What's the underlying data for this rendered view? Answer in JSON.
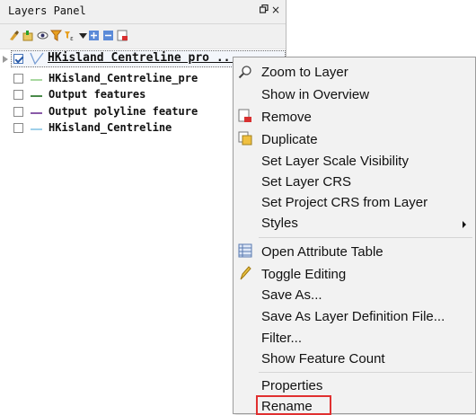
{
  "panel": {
    "title": "Layers Panel",
    "float_icon": "restore-icon",
    "close_glyph": "×",
    "toolbar_icons": [
      "style-brush-icon",
      "add-group-icon",
      "eye-icon",
      "filter-icon",
      "filter-legend-icon",
      "dropdown-icon",
      "expand-all-icon",
      "collapse-all-icon",
      "remove-layer-icon"
    ]
  },
  "layers": [
    {
      "name": "HKisland Centreline pro ...",
      "checked": true,
      "symbol_color": "#7a9fd4",
      "selected": true
    },
    {
      "name": "HKisland_Centreline_pre",
      "checked": false,
      "symbol_color": "#a8d8a0"
    },
    {
      "name": "Output features",
      "checked": false,
      "symbol_color": "#4a8a4a"
    },
    {
      "name": "Output polyline feature",
      "checked": false,
      "symbol_color": "#8a5aa8"
    },
    {
      "name": "HKisland_Centreline",
      "checked": false,
      "symbol_color": "#9fd0ea"
    }
  ],
  "menu": {
    "items": [
      {
        "label": "Zoom to Layer",
        "icon": "zoom-icon"
      },
      {
        "label": "Show in Overview"
      },
      {
        "label": "Remove",
        "icon": "remove-icon"
      },
      {
        "label": "Duplicate",
        "icon": "duplicate-icon"
      },
      {
        "label": "Set Layer Scale Visibility"
      },
      {
        "label": "Set Layer CRS"
      },
      {
        "label": "Set Project CRS from Layer"
      },
      {
        "label": "Styles",
        "submenu": true
      },
      {
        "label": "Open Attribute Table",
        "icon": "table-icon"
      },
      {
        "label": "Toggle Editing",
        "icon": "pencil-icon"
      },
      {
        "label": "Save As..."
      },
      {
        "label": "Save As Layer Definition File..."
      },
      {
        "label": "Filter..."
      },
      {
        "label": "Show Feature Count"
      },
      {
        "label": "Properties"
      },
      {
        "label": "Rename",
        "highlighted": true
      }
    ],
    "highlight_color": "#e03030"
  }
}
